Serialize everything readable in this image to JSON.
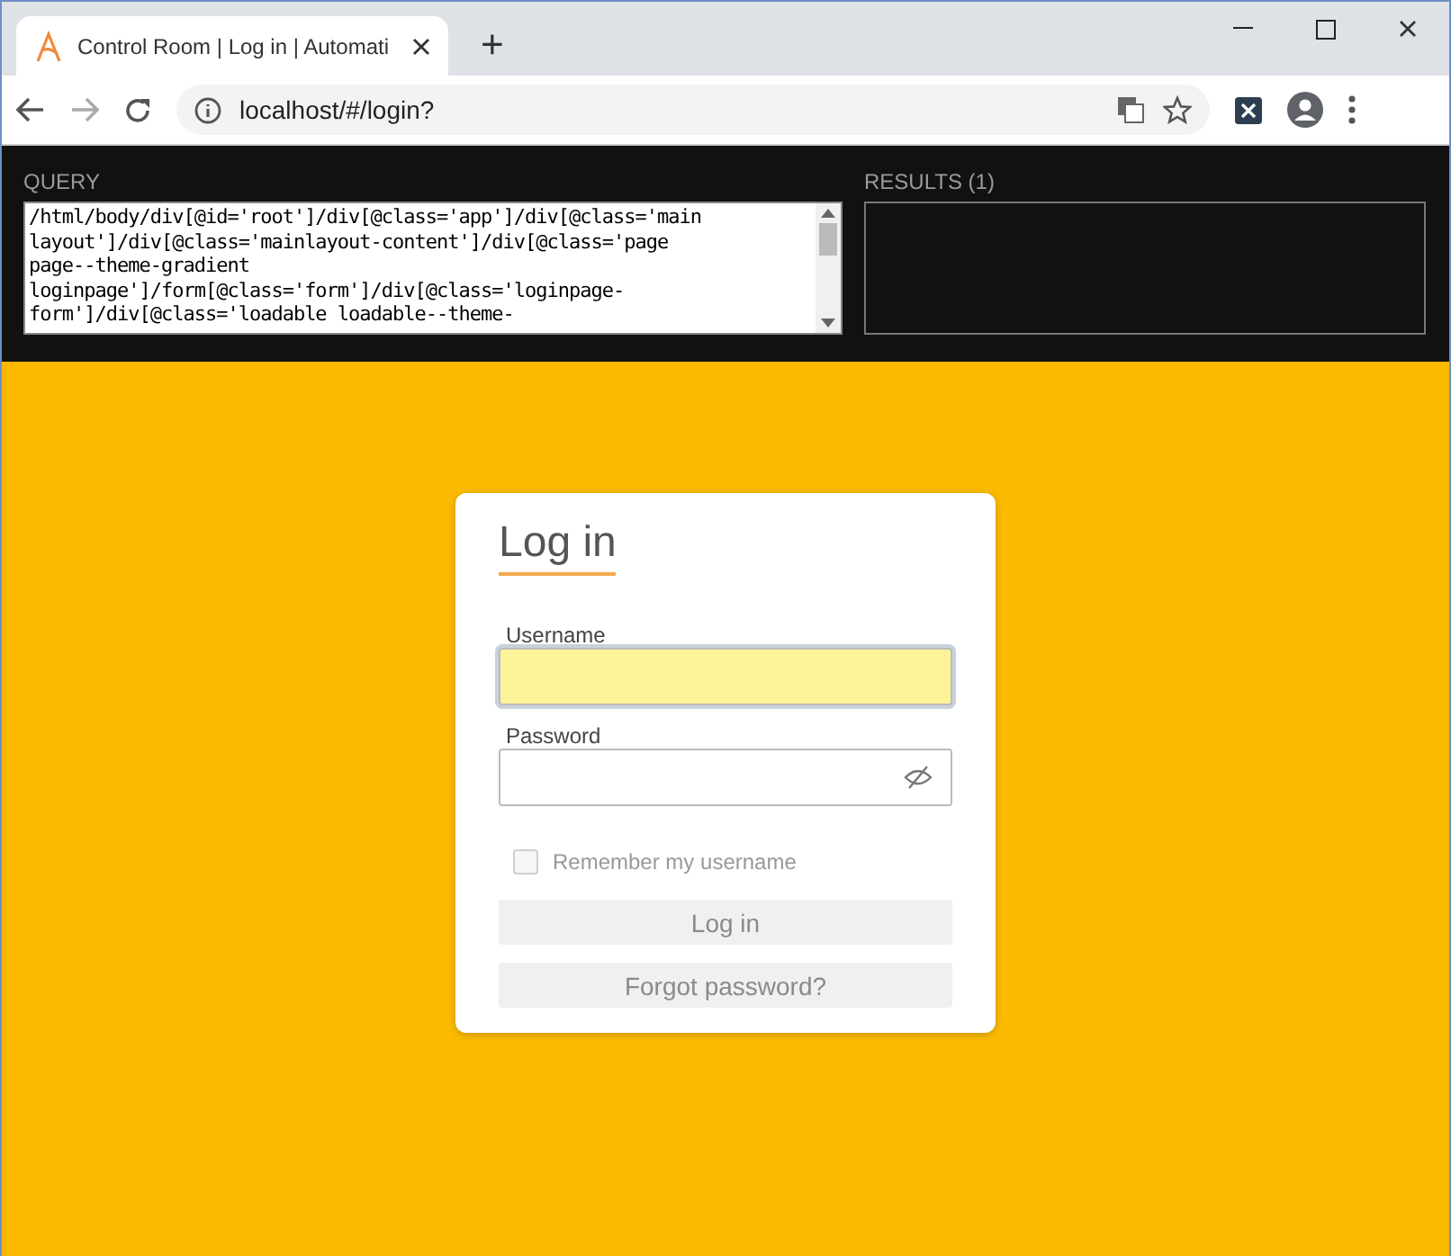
{
  "browser": {
    "tab_title": "Control Room | Log in | Automati",
    "new_tab": "+",
    "url": "localhost/#/login?"
  },
  "inspector": {
    "query_label": "QUERY",
    "query_lines": [
      "/html/body/div[@id='root']/div[@class='app']/div[@class='main",
      "layout']/div[@class='mainlayout-content']/div[@class='page",
      "page--theme-gradient",
      "loginpage']/form[@class='form']/div[@class='loginpage-",
      "form']/div[@class='loadable loadable--theme-"
    ],
    "results_label": "RESULTS (1)"
  },
  "login": {
    "title": "Log in",
    "username_label": "Username",
    "username_focused": true,
    "password_label": "Password",
    "remember": {
      "label": "Remember my username",
      "checked": false,
      "disabled": true
    },
    "buttons": [
      {
        "label": "Log in",
        "disabled": true
      },
      {
        "label": "Forgot password?",
        "disabled": true
      }
    ]
  }
}
